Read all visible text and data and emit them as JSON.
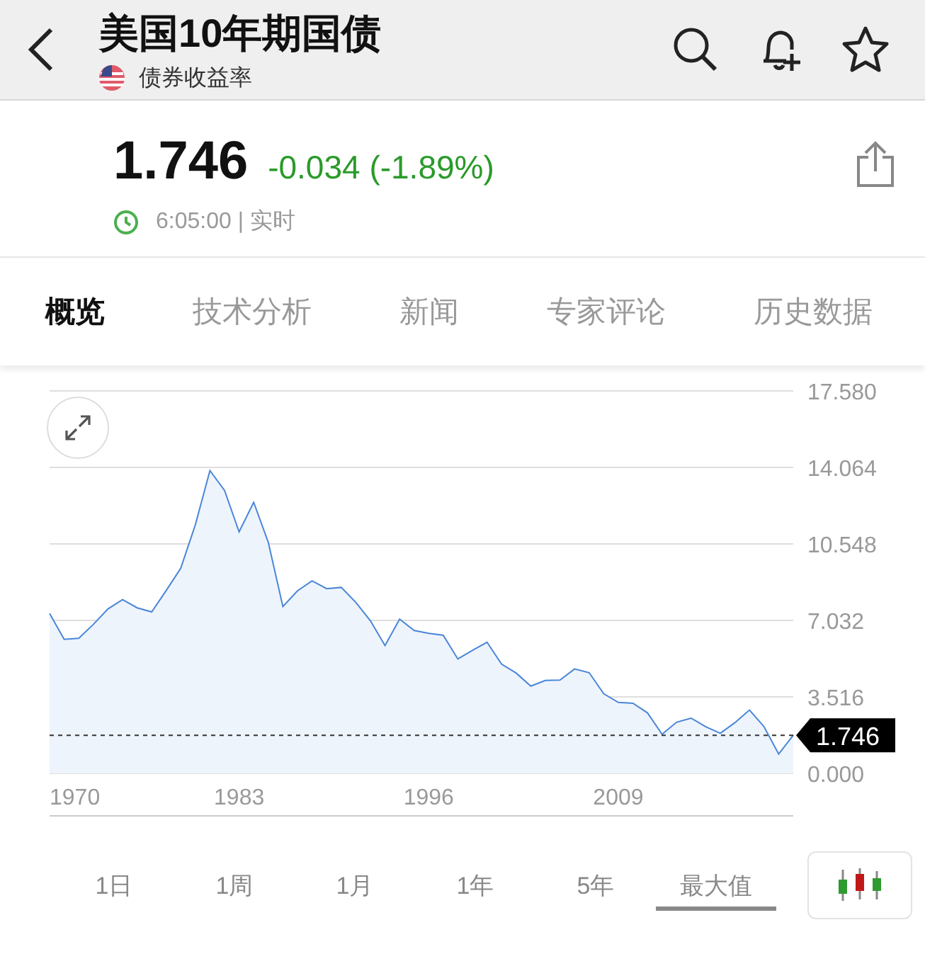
{
  "header": {
    "title": "美国10年期国债",
    "subtitle": "债券收益率"
  },
  "quote": {
    "price": "1.746",
    "change": "-0.034 (-1.89%)",
    "time": "6:05:00 | 实时"
  },
  "tabs": [
    {
      "label": "概览",
      "selected": true
    },
    {
      "label": "技术分析",
      "selected": false
    },
    {
      "label": "新闻",
      "selected": false
    },
    {
      "label": "专家评论",
      "selected": false
    },
    {
      "label": "历史数据",
      "selected": false
    }
  ],
  "chart": {
    "chart_data": {
      "type": "area",
      "x": [
        1970,
        1971,
        1972,
        1973,
        1974,
        1975,
        1976,
        1977,
        1978,
        1979,
        1980,
        1981,
        1982,
        1983,
        1984,
        1985,
        1986,
        1987,
        1988,
        1989,
        1990,
        1991,
        1992,
        1993,
        1994,
        1995,
        1996,
        1997,
        1998,
        1999,
        2000,
        2001,
        2002,
        2003,
        2004,
        2005,
        2006,
        2007,
        2008,
        2009,
        2010,
        2011,
        2012,
        2013,
        2014,
        2015,
        2016,
        2017,
        2018,
        2019,
        2020,
        2021
      ],
      "series": [
        {
          "color": "#4a86d8",
          "values": [
            7.35,
            6.16,
            6.21,
            6.85,
            7.56,
            7.99,
            7.61,
            7.42,
            8.41,
            9.43,
            11.43,
            13.92,
            13.01,
            11.1,
            12.46,
            10.62,
            7.67,
            8.39,
            8.85,
            8.49,
            8.55,
            7.86,
            7.01,
            5.87,
            7.09,
            6.57,
            6.44,
            6.35,
            5.26,
            5.65,
            6.03,
            5.02,
            4.61,
            4.01,
            4.27,
            4.29,
            4.8,
            4.63,
            3.66,
            3.26,
            3.22,
            2.78,
            1.8,
            2.35,
            2.54,
            2.14,
            1.84,
            2.33,
            2.91,
            2.14,
            0.89,
            1.75
          ]
        },
        {
          "type": "line",
          "line_style": "dashed",
          "color": "#333333",
          "values": [
            1.75,
            1.75,
            1.75,
            1.75,
            1.75,
            1.75,
            1.75,
            1.75,
            1.75,
            1.75,
            1.75,
            1.75,
            1.75,
            1.75,
            1.75,
            1.75,
            1.75,
            1.75,
            1.75,
            1.75,
            1.75,
            1.75,
            1.75,
            1.75,
            1.75,
            1.75,
            1.75,
            1.75,
            1.75,
            1.75,
            1.75,
            1.75,
            1.75,
            1.75,
            1.75,
            1.75,
            1.75,
            1.75,
            1.75,
            1.75,
            1.75,
            1.75,
            1.75,
            1.75,
            1.75,
            1.75,
            1.75,
            1.75,
            1.75,
            1.75,
            1.75,
            1.75
          ]
        }
      ],
      "grid": true,
      "xlim": [
        1970,
        2021
      ],
      "ylim": [
        0,
        17.58
      ],
      "xticks": [
        1970,
        1983,
        1996,
        2009
      ],
      "yticks": [
        {
          "value": 0,
          "label": "0.000"
        },
        {
          "value": 3.516,
          "label": "3.516"
        },
        {
          "value": 7.032,
          "label": "7.032"
        },
        {
          "value": 10.548,
          "label": "10.548"
        },
        {
          "value": 14.064,
          "label": "14.064"
        },
        {
          "value": 17.58,
          "label": "17.580"
        }
      ],
      "annotations": [
        {
          "x": 2021,
          "y": 1.746,
          "text": "1.746"
        }
      ]
    }
  },
  "ranges": [
    {
      "label": "1日",
      "selected": false
    },
    {
      "label": "1周",
      "selected": false
    },
    {
      "label": "1月",
      "selected": false
    },
    {
      "label": "1年",
      "selected": false
    },
    {
      "label": "5年",
      "selected": false
    },
    {
      "label": "最大值",
      "selected": true
    }
  ]
}
